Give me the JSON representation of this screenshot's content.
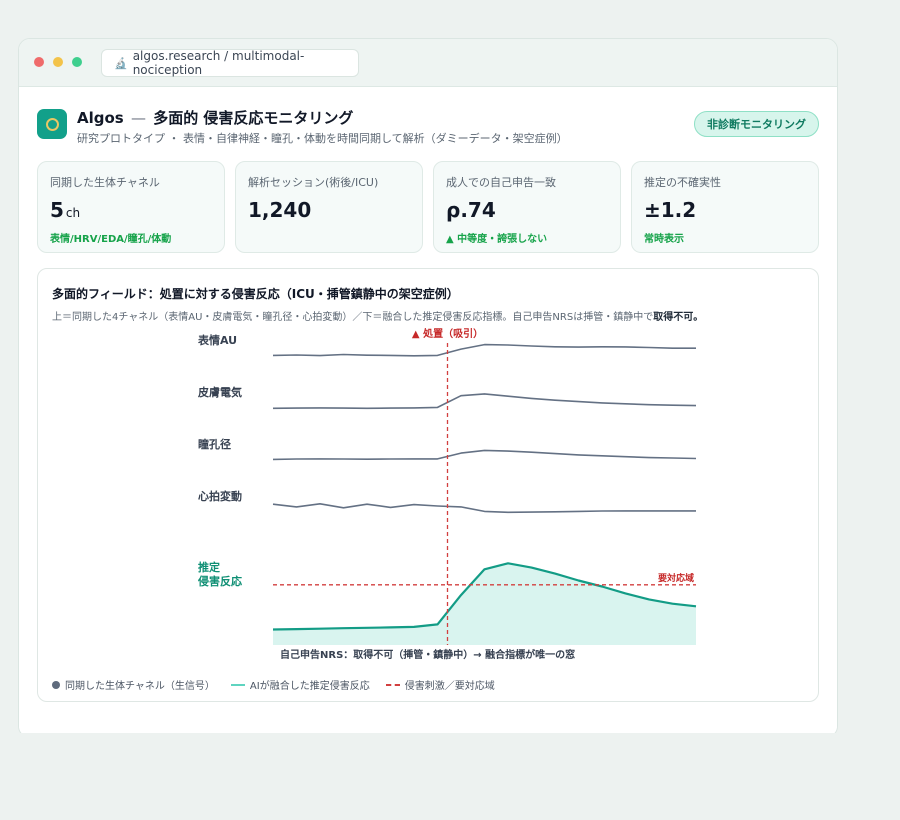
{
  "browser": {
    "url": "algos.research / multimodal-nociception",
    "url_icon": "microscope-icon"
  },
  "header": {
    "brand": "Algos",
    "separator": "—",
    "title": "多面的 侵害反応モニタリング",
    "subtitle": "研究プロトタイプ ・ 表情・自律神経・瞳孔・体動を時間同期して解析（ダミーデータ・架空症例）",
    "badge": "非診断モニタリング"
  },
  "stats": [
    {
      "label": "同期した生体チャネル",
      "value": "5",
      "unit": "ch",
      "note": "表情/HRV/EDA/瞳孔/体動"
    },
    {
      "label": "解析セッション(術後/ICU)",
      "value": "1,240",
      "unit": "",
      "note": ""
    },
    {
      "label": "成人での自己申告一致",
      "value": "ρ.74",
      "unit": "",
      "note": "▲ 中等度・誇張しない"
    },
    {
      "label": "推定の不確実性",
      "value": "±1.2",
      "unit": "",
      "note": "常時表示"
    }
  ],
  "panel": {
    "title": "多面的フィールド：処置に対する侵害反応（ICU・挿管鎮静中の架空症例）",
    "desc_prefix": "上＝同期した4チャネル（表情AU・皮膚電気・瞳孔径・心拍変動）／下＝融合した推定侵害反応指標。自己申告NRSは挿管・鎮静中で",
    "desc_emphasis": "取得不可。"
  },
  "chart_data": {
    "type": "line",
    "event_label": "▲ 処置（吸引）",
    "threshold_label": "要対応域",
    "footer_label": "自己申告NRS：取得不可（挿管・鎮静中）→ 融合指標が唯一の窓",
    "colors": {
      "channel": "#647184",
      "fused": "#139c86",
      "fused_fill": "#d9f4ef",
      "event": "#d23f3f"
    },
    "x": [
      0,
      1,
      2,
      3,
      4,
      5,
      6,
      7,
      8,
      9,
      10,
      11,
      12,
      13,
      14,
      15,
      16,
      17,
      18
    ],
    "event_x": 7,
    "threshold": 0.7,
    "series": [
      {
        "name": "表情AU",
        "values": [
          0.2,
          0.22,
          0.19,
          0.25,
          0.21,
          0.2,
          0.18,
          0.2,
          0.55,
          0.8,
          0.78,
          0.72,
          0.68,
          0.66,
          0.68,
          0.67,
          0.64,
          0.6,
          0.6
        ]
      },
      {
        "name": "皮膚電気",
        "values": [
          0.15,
          0.16,
          0.17,
          0.16,
          0.15,
          0.16,
          0.17,
          0.2,
          0.85,
          0.95,
          0.82,
          0.7,
          0.6,
          0.52,
          0.45,
          0.4,
          0.35,
          0.32,
          0.3
        ]
      },
      {
        "name": "瞳孔径",
        "values": [
          0.2,
          0.22,
          0.23,
          0.22,
          0.21,
          0.22,
          0.23,
          0.23,
          0.55,
          0.7,
          0.66,
          0.6,
          0.52,
          0.45,
          0.4,
          0.35,
          0.3,
          0.28,
          0.25
        ]
      },
      {
        "name": "心拍変動",
        "values": [
          0.6,
          0.45,
          0.62,
          0.4,
          0.6,
          0.42,
          0.58,
          0.5,
          0.45,
          0.2,
          0.15,
          0.16,
          0.18,
          0.2,
          0.22,
          0.23,
          0.23,
          0.23,
          0.23
        ]
      }
    ],
    "fused": {
      "name": "推定\n侵害反応",
      "values": [
        0.18,
        0.185,
        0.19,
        0.195,
        0.2,
        0.205,
        0.21,
        0.24,
        0.58,
        0.88,
        0.95,
        0.9,
        0.83,
        0.75,
        0.68,
        0.6,
        0.53,
        0.48,
        0.45
      ]
    },
    "legend": [
      {
        "marker": "dot",
        "label": "同期した生体チャネル（生信号）"
      },
      {
        "marker": "line",
        "label": "AIが融合した推定侵害反応"
      },
      {
        "marker": "dash",
        "label": "侵害刺激／要対応域"
      }
    ]
  }
}
